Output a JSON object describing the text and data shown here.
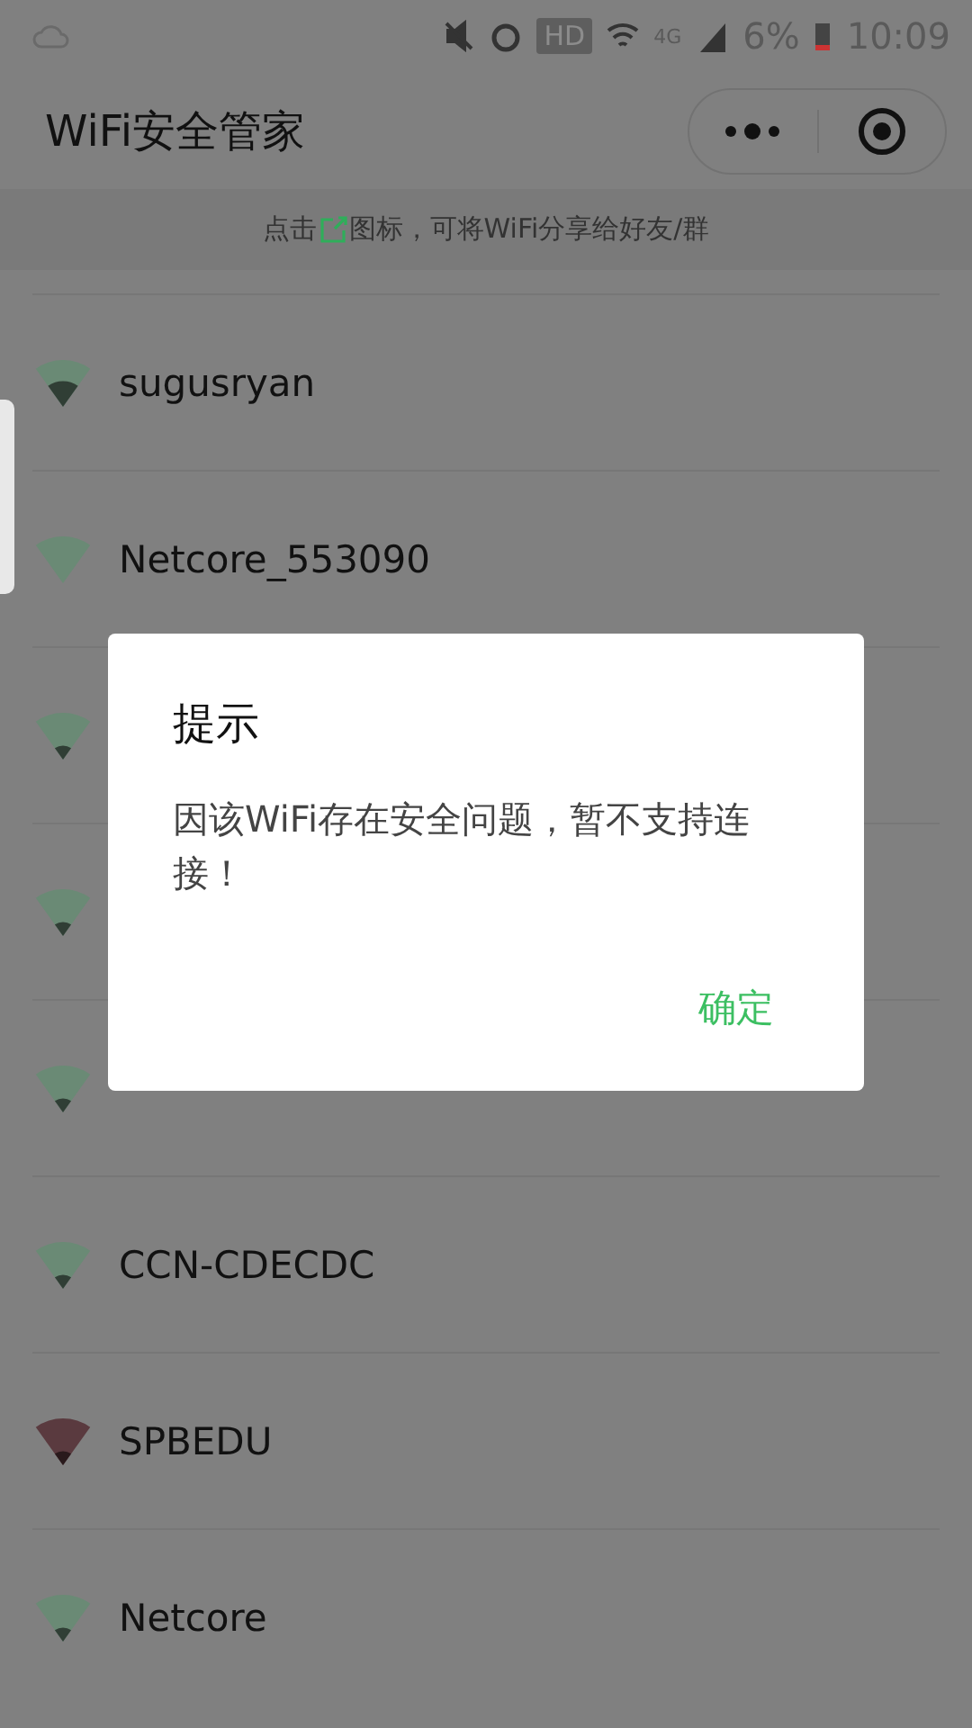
{
  "status_bar": {
    "hd": "HD",
    "network": "4G",
    "battery": "6%",
    "time": "10:09"
  },
  "nav": {
    "title": "WiFi安全管家"
  },
  "hint": {
    "before": "点击",
    "after": "图标，可将WiFi分享给好友/群"
  },
  "rows": [
    {
      "name": "sugusryan",
      "kind": "medium",
      "color": "#6a8a75"
    },
    {
      "name": "Netcore_553090",
      "kind": "none",
      "color": "#6a8a75"
    },
    {
      "kind": "weak",
      "color": "#6a8a75"
    },
    {
      "kind": "weak",
      "color": "#6a8a75"
    },
    {
      "kind": "weak",
      "color": "#6a8a75"
    },
    {
      "name": "CCN-CDECDC",
      "kind": "weak",
      "color": "#6a8a75"
    },
    {
      "name": "SPBEDU",
      "kind": "weak",
      "color": "#5a3a3f"
    },
    {
      "name": "Netcore",
      "kind": "weak",
      "color": "#6a8a75"
    }
  ],
  "dialog": {
    "title": "提示",
    "message": "因该WiFi存在安全问题，暂不支持连接！",
    "button": "确定"
  }
}
